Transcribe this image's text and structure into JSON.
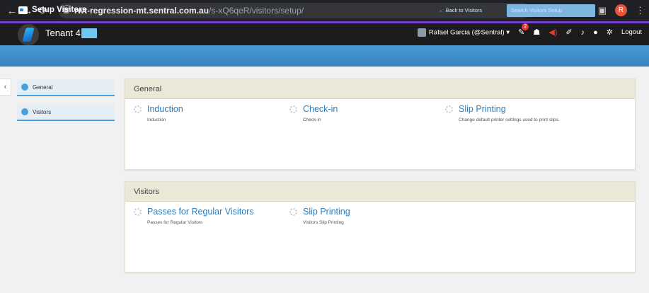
{
  "browser": {
    "url_host": "rwt-regression-mt.sentral.com.au",
    "url_path": "/s-xQ6qeR/visitors/setup/",
    "profile_initial": "R"
  },
  "header": {
    "tenant": "Tenant 4",
    "user": "Rafael Garcia (@Sentral) ▾",
    "notification_count": "2",
    "logout": "Logout"
  },
  "section": {
    "title": "Setup Visitors",
    "back_link": "← Back to Visitors",
    "search_placeholder": "Search Visitors Setup"
  },
  "sidebar": {
    "items": [
      {
        "label": "General"
      },
      {
        "label": "Visitors"
      }
    ]
  },
  "panels": [
    {
      "title": "General",
      "items": [
        {
          "title": "Induction",
          "desc": "Induction"
        },
        {
          "title": "Check-in",
          "desc": "Check-in"
        },
        {
          "title": "Slip Printing",
          "desc": "Change default printer settings used to print slips."
        }
      ]
    },
    {
      "title": "Visitors",
      "items": [
        {
          "title": "Passes for Regular Visitors",
          "desc": "Passes for Regular Visitors"
        },
        {
          "title": "Slip Printing",
          "desc": "Visitors Slip Printing"
        }
      ]
    }
  ]
}
